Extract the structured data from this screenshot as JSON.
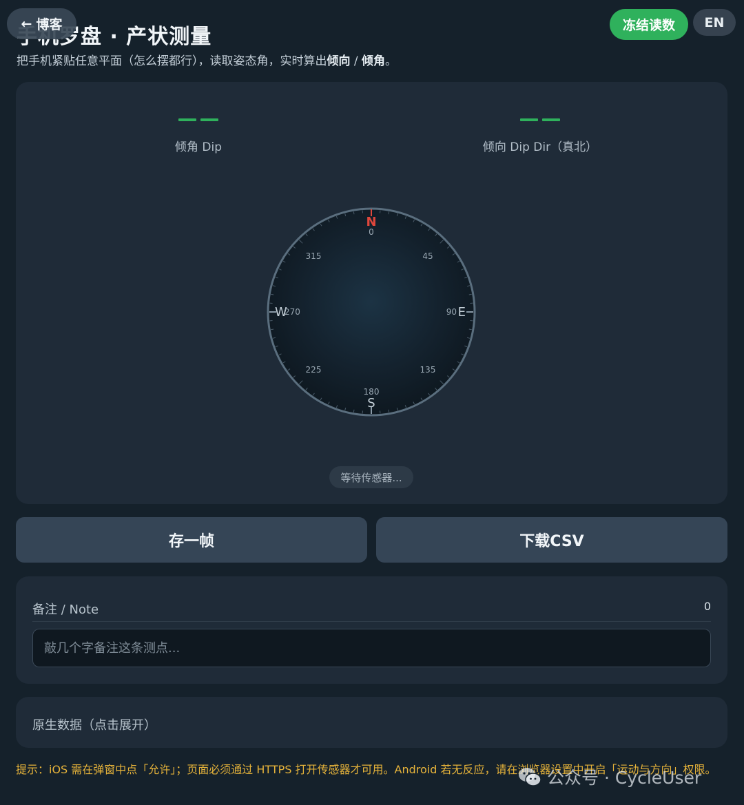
{
  "header": {
    "title": "手机罗盘 · 产状测量",
    "subtitle_prefix": "把手机紧贴任意平面（怎么摆都行），读取姿态角，实时算出",
    "subtitle_bold1": "倾向",
    "subtitle_sep": " / ",
    "subtitle_bold2": "倾角",
    "subtitle_suffix": "。",
    "back_label": "博客",
    "back_arrow": "←",
    "freeze_label": "冻结读数",
    "lang_label": "EN"
  },
  "readings": {
    "dip_value": "——",
    "dip_label": "倾角 Dip",
    "dipdir_value": "——",
    "dipdir_label": "倾向 Dip Dir（真北）"
  },
  "compass": {
    "north": "N",
    "south": "S",
    "east": "E",
    "west": "W",
    "deg_0": "0",
    "deg_45": "45",
    "deg_90": "90",
    "deg_135": "135",
    "deg_180": "180",
    "deg_225": "225",
    "deg_270": "270",
    "deg_315": "315",
    "north_color": "#e0473c"
  },
  "status": "等待传感器...",
  "actions": {
    "save_frame": "存一帧",
    "download_csv": "下载CSV"
  },
  "note": {
    "label": "备注 / Note",
    "count": "0",
    "placeholder": "敲几个字备注这条测点..."
  },
  "raw": {
    "label": "原生数据（点击展开）"
  },
  "hint": "提示：iOS 需在弹窗中点「允许」；页面必须通过 HTTPS 打开传感器才可用。Android 若无反应，请在浏览器设置中开启「运动与方向」权限。",
  "watermark": {
    "text": "公众号 · CycleUser",
    "icon": "wechat-icon"
  },
  "colors": {
    "background": "#15212b",
    "card": "#1f2b38",
    "accent_green": "#2fb15c",
    "hint_yellow": "#e6b33a",
    "north_red": "#e0473c"
  }
}
